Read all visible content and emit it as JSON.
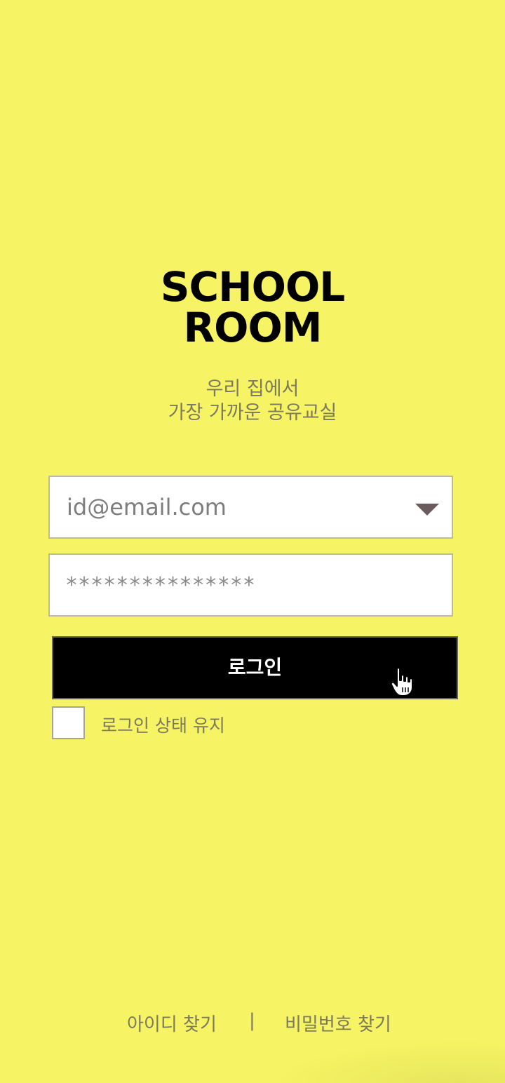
{
  "logo": {
    "line1": "SCHOOL",
    "line2": "ROOM"
  },
  "tagline": {
    "line1": "우리 집에서",
    "line2": "가장 가까운 공유교실"
  },
  "form": {
    "email_placeholder": "id@email.com",
    "password_placeholder": "***************",
    "login_label": "로그인",
    "remember_label": "로그인 상태 유지"
  },
  "footer": {
    "find_id": "아이디 찾기",
    "divider": "|",
    "find_password": "비밀번호 찾기"
  },
  "colors": {
    "background": "#f6f364",
    "button": "#000000",
    "muted_text": "#7c7a5e"
  },
  "icons": {
    "dropdown": "triangle-down-icon",
    "cursor": "hand-pointer-icon"
  }
}
